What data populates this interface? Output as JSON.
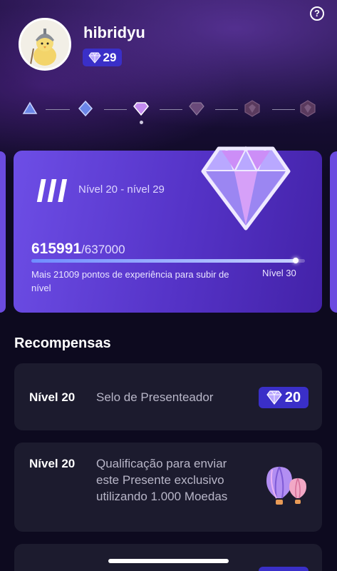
{
  "profile": {
    "username": "hibridyu",
    "level": "29"
  },
  "help_icon_glyph": "?",
  "tiers": [
    {
      "name": "tier-1-icon",
      "color": "#6b86e8"
    },
    {
      "name": "tier-2-icon",
      "color": "#6b86e8"
    },
    {
      "name": "tier-3-icon",
      "color": "#c48bf0"
    },
    {
      "name": "tier-4-icon",
      "color": "#6a4a7a"
    },
    {
      "name": "tier-5-icon",
      "color": "#5a3a5e"
    },
    {
      "name": "tier-6-icon",
      "color": "#5a3a5e"
    }
  ],
  "level_card": {
    "roman": "III",
    "range": "Nível 20 - nível 29",
    "xp_current": "615991",
    "xp_total": "/637000",
    "progress": 0.967,
    "hint": "Mais 21009 pontos de experiência para subir de nível",
    "next_level": "Nível 30"
  },
  "rewards": {
    "title": "Recompensas",
    "items": [
      {
        "level": "Nível 20",
        "description": "Selo de Presenteador",
        "badge": "20"
      },
      {
        "level": "Nível 20",
        "description": "Qualificação para enviar este Presente exclusivo utilizando 1.000 Moedas",
        "image": "hot-air-balloon-gift"
      }
    ]
  },
  "colors": {
    "accent": "#3a2fc8",
    "card": "#6d4ee6",
    "background": "#0d0a1f"
  }
}
